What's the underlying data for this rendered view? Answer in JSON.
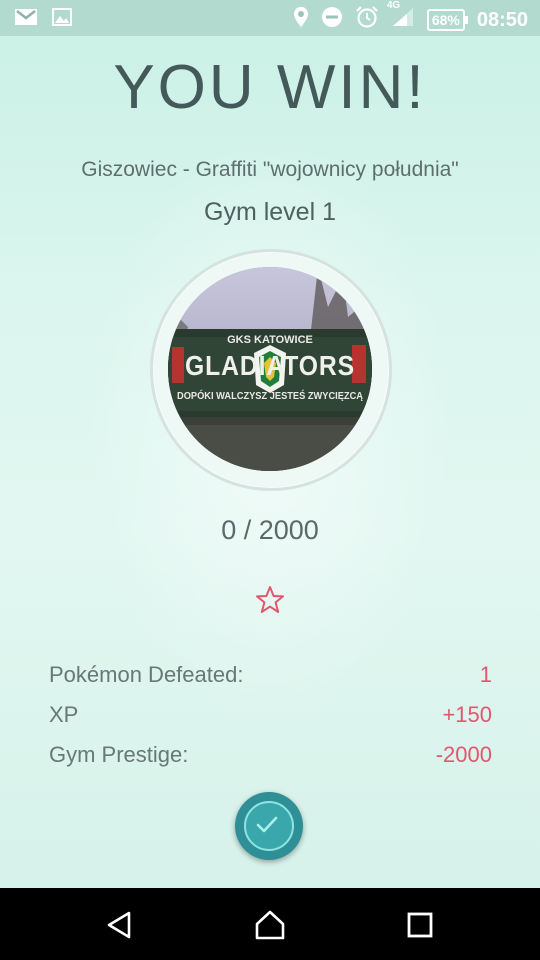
{
  "status_bar": {
    "left_icons": [
      "gmail-icon",
      "gallery-icon"
    ],
    "right_icons": [
      "location-icon",
      "do-not-disturb-icon",
      "alarm-icon",
      "signal-4g-icon"
    ],
    "network_label": "4G",
    "battery": "68%",
    "time": "08:50"
  },
  "result": {
    "title": "YOU WIN!",
    "gym_name": "Giszowiec - Graffiti \"wojownicy południa\"",
    "gym_level": "Gym level 1",
    "progress": "0 / 2000",
    "photo_text": {
      "line1": "GKS KATOWICE",
      "line2": "GLADIATORS",
      "line3": "DOPÓKI WALCZYSZ JESTEŚ ZWYCIĘZCĄ"
    }
  },
  "stats": [
    {
      "label": "Pokémon Defeated:",
      "value": "1"
    },
    {
      "label": "XP",
      "value": "+150"
    },
    {
      "label": "Gym Prestige:",
      "value": "-2000"
    }
  ],
  "colors": {
    "accent_red": "#e2566e",
    "button_teal": "#2f8f96",
    "title_gray": "#44595a"
  },
  "nav": {
    "icons": [
      "back-icon",
      "home-icon",
      "recents-icon"
    ]
  }
}
